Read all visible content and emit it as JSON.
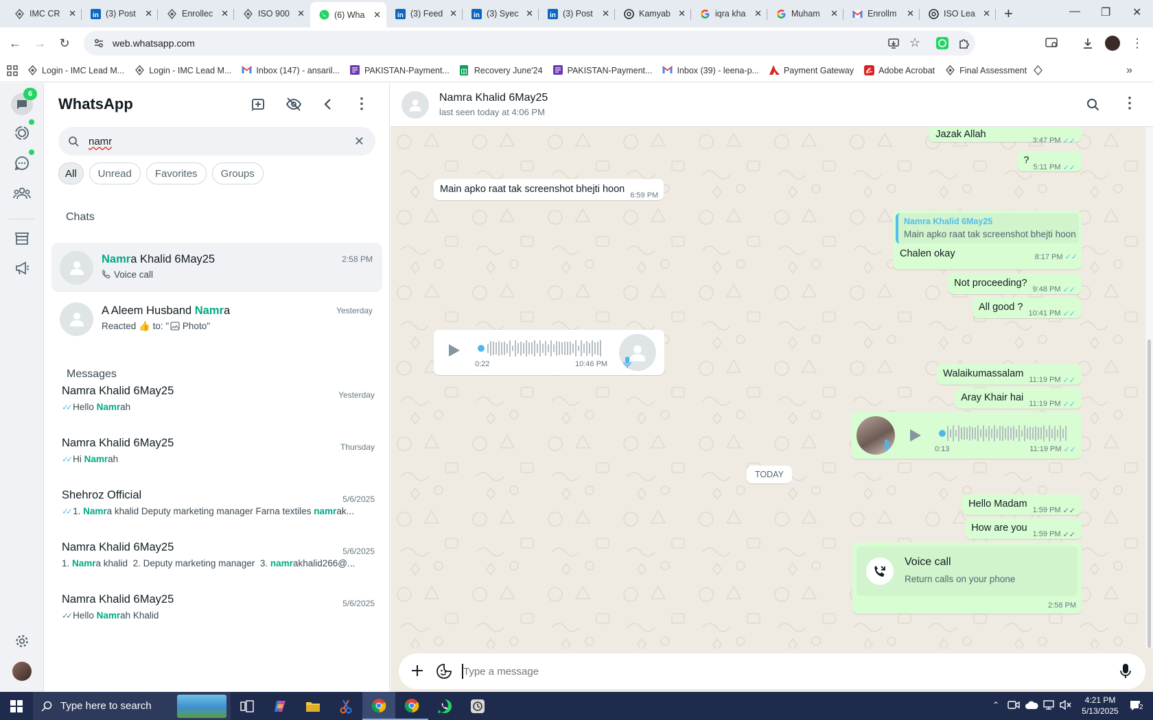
{
  "browser": {
    "tabs": [
      {
        "title": "IMC CR",
        "icon": "imc-icon",
        "active": false
      },
      {
        "title": "(3) Post",
        "icon": "linkedin-icon",
        "active": false
      },
      {
        "title": "Enrollec",
        "icon": "imc-icon",
        "active": false
      },
      {
        "title": "ISO 900",
        "icon": "imc-icon",
        "active": false
      },
      {
        "title": "(6) Wha",
        "icon": "whatsapp-icon",
        "active": true
      },
      {
        "title": "(3) Feed",
        "icon": "linkedin-icon",
        "active": false
      },
      {
        "title": "(3) Syec",
        "icon": "linkedin-icon",
        "active": false
      },
      {
        "title": "(3) Post",
        "icon": "linkedin-icon",
        "active": false
      },
      {
        "title": "Kamyab",
        "icon": "openai-icon",
        "active": false
      },
      {
        "title": "iqra kha",
        "icon": "google-icon",
        "active": false
      },
      {
        "title": "Muham",
        "icon": "google-icon",
        "active": false
      },
      {
        "title": "Enrollm",
        "icon": "gmail-icon",
        "active": false
      },
      {
        "title": "ISO Lea",
        "icon": "openai-icon",
        "active": false
      }
    ],
    "url": "web.whatsapp.com",
    "bookmarks": [
      {
        "label": "Login - IMC Lead M...",
        "icon": "imc-icon"
      },
      {
        "label": "Login - IMC Lead M...",
        "icon": "imc-icon"
      },
      {
        "label": "Inbox (147) - ansaril...",
        "icon": "gmail-icon"
      },
      {
        "label": "PAKISTAN-Payment...",
        "icon": "purple-doc-icon"
      },
      {
        "label": "Recovery June'24",
        "icon": "sheets-icon"
      },
      {
        "label": "PAKISTAN-Payment...",
        "icon": "purple-doc-icon"
      },
      {
        "label": "Inbox (39) - leena-p...",
        "icon": "gmail-icon"
      },
      {
        "label": "Payment Gateway",
        "icon": "adobe-icon"
      },
      {
        "label": "Adobe Acrobat",
        "icon": "acrobat-icon"
      },
      {
        "label": "Final Assessment",
        "icon": "imc-icon"
      }
    ]
  },
  "rail": {
    "chats_badge": "6"
  },
  "panel": {
    "title": "WhatsApp",
    "search_value": "namr",
    "filters": [
      "All",
      "Unread",
      "Favorites",
      "Groups"
    ],
    "chats_heading": "Chats",
    "messages_heading": "Messages",
    "chats": [
      {
        "name_hi": "Namr",
        "name_rest": "a Khalid 6May25",
        "name_pre": "",
        "time": "2:58 PM",
        "preview": "Voice call",
        "selected": true
      },
      {
        "name_pre": "A Aleem Husband ",
        "name_hi": "Namr",
        "name_rest": "a",
        "time": "Yesterday",
        "preview_pre": "Reacted ",
        "preview_emoji": "👍",
        "preview_mid": " to: \"",
        "preview_post": " Photo\"",
        "selected": false
      }
    ],
    "messages": [
      {
        "name": "Namra Khalid 6May25",
        "date": "Yesterday",
        "tick": "read",
        "parts": [
          {
            "t": "Hello "
          },
          {
            "t": "Namr",
            "h": true
          },
          {
            "t": "ah"
          }
        ]
      },
      {
        "name": "Namra Khalid 6May25",
        "date": "Thursday",
        "tick": "read",
        "parts": [
          {
            "t": "Hi "
          },
          {
            "t": "Namr",
            "h": true
          },
          {
            "t": "ah"
          }
        ]
      },
      {
        "name": "Shehroz Official",
        "date": "5/6/2025",
        "tick": "read",
        "parts": [
          {
            "t": "1. "
          },
          {
            "t": "Namr",
            "h": true
          },
          {
            "t": "a khalid Deputy marketing manager Farna textiles "
          },
          {
            "t": "namr",
            "h": true
          },
          {
            "t": "ak..."
          }
        ]
      },
      {
        "name": "Namra Khalid 6May25",
        "date": "5/6/2025",
        "tick": "none",
        "parts": [
          {
            "t": "1. "
          },
          {
            "t": "Namr",
            "h": true
          },
          {
            "t": "a khalid  2. Deputy marketing manager  3. "
          },
          {
            "t": "namr",
            "h": true
          },
          {
            "t": "akhalid266@..."
          }
        ]
      },
      {
        "name": "Namra Khalid 6May25",
        "date": "5/6/2025",
        "tick": "sent",
        "parts": [
          {
            "t": "Hello "
          },
          {
            "t": "Namr",
            "h": true
          },
          {
            "t": "ah Khalid"
          }
        ]
      }
    ]
  },
  "chat": {
    "contact_name": "Namra Khalid 6May25",
    "last_seen": "last seen today at 4:06 PM",
    "msg_jazak": {
      "text": "Jazak Allah",
      "time": "3:47 PM"
    },
    "msg_q": {
      "text": "?",
      "time": "5:11 PM"
    },
    "msg_incoming": {
      "text": "Main apko raat tak screenshot bhejti hoon",
      "time": "6:59 PM"
    },
    "msg_reply": {
      "quote_author": "Namra Khalid 6May25",
      "quote_text": "Main apko raat tak screenshot bhejti hoon",
      "text": "Chalen okay",
      "time": "8:17 PM"
    },
    "msg_proceed": {
      "text": "Not proceeding?",
      "time": "9:48 PM"
    },
    "msg_allgood": {
      "text": "All good ?",
      "time": "10:41 PM"
    },
    "voice_in": {
      "duration": "0:22",
      "time": "10:46 PM"
    },
    "msg_walaikum": {
      "text": "Walaikumassalam",
      "time": "11:19 PM"
    },
    "msg_khair": {
      "text": "Aray Khair hai",
      "time": "11:19 PM"
    },
    "voice_out": {
      "duration": "0:13",
      "time": "11:19 PM"
    },
    "date_divider": "TODAY",
    "msg_hello": {
      "text": "Hello Madam",
      "time": "1:59 PM"
    },
    "msg_howare": {
      "text": "How are you",
      "time": "1:59 PM"
    },
    "voicecall": {
      "title": "Voice call",
      "subtitle": "Return calls on your phone",
      "time": "2:58 PM"
    },
    "composer_placeholder": "Type a message"
  },
  "taskbar": {
    "search_placeholder": "Type here to search",
    "time": "4:21 PM",
    "date": "5/13/2025",
    "notif_count": "2"
  },
  "colors": {
    "accent": "#00a884",
    "outgoing": "#d9fdd3",
    "tick_blue": "#53bdeb",
    "taskbar": "#1f2b4d"
  }
}
